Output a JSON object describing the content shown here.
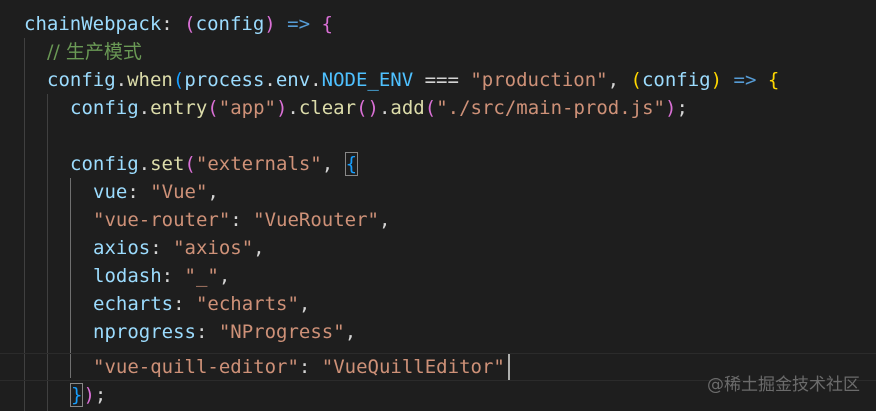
{
  "editor": {
    "lines": [
      {
        "t": [
          {
            "text": "chainWebpack",
            "c": "tk-prop"
          },
          {
            "text": ": ",
            "c": "tk-op"
          },
          {
            "text": "(",
            "c": "tk-b2"
          },
          {
            "text": "config",
            "c": "tk-prop"
          },
          {
            "text": ")",
            "c": "tk-b2"
          },
          {
            "text": " ",
            "c": "tk-op"
          },
          {
            "text": "=>",
            "c": "tk-kw"
          },
          {
            "text": " ",
            "c": "tk-op"
          },
          {
            "text": "{",
            "c": "tk-b2"
          }
        ]
      },
      {
        "t": [
          {
            "text": "// 生产模式",
            "c": "tk-cmt"
          }
        ]
      },
      {
        "t": [
          {
            "text": "config",
            "c": "tk-prop"
          },
          {
            "text": ".",
            "c": "tk-op"
          },
          {
            "text": "when",
            "c": "tk-func"
          },
          {
            "text": "(",
            "c": "tk-b3"
          },
          {
            "text": "process",
            "c": "tk-prop"
          },
          {
            "text": ".",
            "c": "tk-op"
          },
          {
            "text": "env",
            "c": "tk-prop"
          },
          {
            "text": ".",
            "c": "tk-op"
          },
          {
            "text": "NODE_ENV",
            "c": "tk-const"
          },
          {
            "text": " === ",
            "c": "tk-op"
          },
          {
            "text": "\"production\"",
            "c": "tk-str"
          },
          {
            "text": ", ",
            "c": "tk-op"
          },
          {
            "text": "(",
            "c": "tk-b1"
          },
          {
            "text": "config",
            "c": "tk-prop"
          },
          {
            "text": ")",
            "c": "tk-b1"
          },
          {
            "text": " ",
            "c": "tk-op"
          },
          {
            "text": "=>",
            "c": "tk-kw"
          },
          {
            "text": " ",
            "c": "tk-op"
          },
          {
            "text": "{",
            "c": "tk-b1"
          }
        ]
      },
      {
        "t": [
          {
            "text": "config",
            "c": "tk-prop"
          },
          {
            "text": ".",
            "c": "tk-op"
          },
          {
            "text": "entry",
            "c": "tk-func"
          },
          {
            "text": "(",
            "c": "tk-b2"
          },
          {
            "text": "\"app\"",
            "c": "tk-str"
          },
          {
            "text": ")",
            "c": "tk-b2"
          },
          {
            "text": ".",
            "c": "tk-op"
          },
          {
            "text": "clear",
            "c": "tk-func"
          },
          {
            "text": "(",
            "c": "tk-b2"
          },
          {
            "text": ")",
            "c": "tk-b2"
          },
          {
            "text": ".",
            "c": "tk-op"
          },
          {
            "text": "add",
            "c": "tk-func"
          },
          {
            "text": "(",
            "c": "tk-b2"
          },
          {
            "text": "\"./src/main-prod.js\"",
            "c": "tk-str"
          },
          {
            "text": ")",
            "c": "tk-b2"
          },
          {
            "text": ";",
            "c": "tk-op"
          }
        ]
      },
      {
        "t": []
      },
      {
        "t": [
          {
            "text": "config",
            "c": "tk-prop"
          },
          {
            "text": ".",
            "c": "tk-op"
          },
          {
            "text": "set",
            "c": "tk-func"
          },
          {
            "text": "(",
            "c": "tk-b2"
          },
          {
            "text": "\"externals\"",
            "c": "tk-str"
          },
          {
            "text": ", ",
            "c": "tk-op"
          },
          {
            "text": "{",
            "c": "tk-b3",
            "box": true
          }
        ]
      },
      {
        "t": [
          {
            "text": "vue",
            "c": "tk-prop"
          },
          {
            "text": ": ",
            "c": "tk-op"
          },
          {
            "text": "\"Vue\"",
            "c": "tk-str"
          },
          {
            "text": ",",
            "c": "tk-op"
          }
        ]
      },
      {
        "t": [
          {
            "text": "\"vue-router\"",
            "c": "tk-str"
          },
          {
            "text": ": ",
            "c": "tk-op"
          },
          {
            "text": "\"VueRouter\"",
            "c": "tk-str"
          },
          {
            "text": ",",
            "c": "tk-op"
          }
        ]
      },
      {
        "t": [
          {
            "text": "axios",
            "c": "tk-prop"
          },
          {
            "text": ": ",
            "c": "tk-op"
          },
          {
            "text": "\"axios\"",
            "c": "tk-str"
          },
          {
            "text": ",",
            "c": "tk-op"
          }
        ]
      },
      {
        "t": [
          {
            "text": "lodash",
            "c": "tk-prop"
          },
          {
            "text": ": ",
            "c": "tk-op"
          },
          {
            "text": "\"_\"",
            "c": "tk-str"
          },
          {
            "text": ",",
            "c": "tk-op"
          }
        ]
      },
      {
        "t": [
          {
            "text": "echarts",
            "c": "tk-prop"
          },
          {
            "text": ": ",
            "c": "tk-op"
          },
          {
            "text": "\"echarts\"",
            "c": "tk-str"
          },
          {
            "text": ",",
            "c": "tk-op"
          }
        ]
      },
      {
        "t": [
          {
            "text": "nprogress",
            "c": "tk-prop"
          },
          {
            "text": ": ",
            "c": "tk-op"
          },
          {
            "text": "\"NProgress\"",
            "c": "tk-str"
          },
          {
            "text": ",",
            "c": "tk-op"
          }
        ]
      },
      {
        "t": [
          {
            "text": "\"vue-quill-editor\"",
            "c": "tk-str"
          },
          {
            "text": ": ",
            "c": "tk-op"
          },
          {
            "text": "\"VueQuillEditor\"",
            "c": "tk-str"
          }
        ]
      },
      {
        "t": [
          {
            "text": "}",
            "c": "tk-b3",
            "box": true
          },
          {
            "text": ")",
            "c": "tk-b2"
          },
          {
            "text": ";",
            "c": "tk-op"
          }
        ]
      }
    ]
  },
  "watermark": "@稀土掘金技术社区"
}
